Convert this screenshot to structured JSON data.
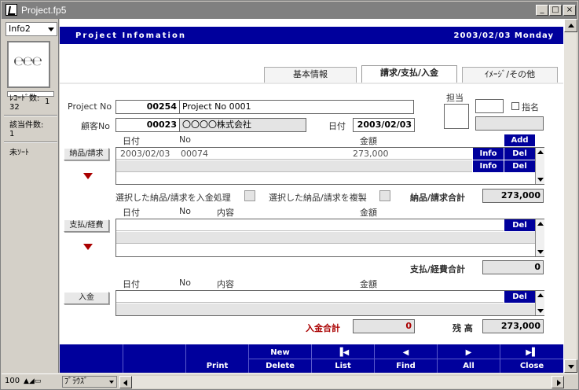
{
  "window": {
    "title": "Project.fp5"
  },
  "sidebar": {
    "layout_select": "Info2",
    "record_indicator": "1",
    "record_count_label": "ﾚｺｰﾄﾞ数:",
    "record_count": "32",
    "found_count_label": "該当件数:",
    "found_count": "1",
    "sort_status": "未ｿｰﾄ"
  },
  "header": {
    "title": "Project Infomation",
    "date": "2003/02/03 Monday"
  },
  "tabs": [
    {
      "label": "基本情報"
    },
    {
      "label": "請求/支払/入金"
    },
    {
      "label": "ｲﾒｰｼﾞ/その他"
    }
  ],
  "project": {
    "no_label": "Project No",
    "no": "00254",
    "name": "Project No 0001",
    "client_no_label": "顧客No",
    "client_no": "00023",
    "client_name": "〇〇〇〇株式会社",
    "date_label": "日付",
    "date": "2003/02/03",
    "staff_label": "担当",
    "designate_label": "指名"
  },
  "invoice": {
    "col_date": "日付",
    "col_no": "No",
    "col_amount": "金額",
    "button": "納品/請求",
    "add": "Add",
    "info": "Info",
    "del": "Del",
    "rows": [
      {
        "date": "2003/02/03",
        "no": "00074",
        "amount": "273,000"
      }
    ],
    "process_label": "選択した納品/請求を入金処理",
    "copy_label": "選択した納品/請求を複製",
    "total_label": "納品/請求合計",
    "total": "273,000"
  },
  "payment": {
    "col_date": "日付",
    "col_no": "No",
    "col_content": "内容",
    "col_amount": "金額",
    "button": "支払/経費",
    "del": "Del",
    "total_label": "支払/経費合計",
    "total": "0"
  },
  "deposit": {
    "col_date": "日付",
    "col_no": "No",
    "col_content": "内容",
    "col_amount": "金額",
    "button": "入金",
    "del": "Del",
    "total_label": "入金合計",
    "total": "0",
    "balance_label": "残 高",
    "balance": "273,000"
  },
  "footer": {
    "new": "New",
    "first": "▐◀",
    "prev": "◀",
    "next": "▶",
    "last": "▶▌",
    "print": "Print",
    "delete": "Delete",
    "list": "List",
    "find": "Find",
    "all": "All",
    "close": "Close"
  },
  "statusbar": {
    "zoom": "100",
    "mode": "ﾌﾞﾗｳｽﾞ"
  },
  "colors": {
    "header_blue": "#00009c",
    "alert_red": "#a00000",
    "field_gray": "#e4e4e4"
  }
}
